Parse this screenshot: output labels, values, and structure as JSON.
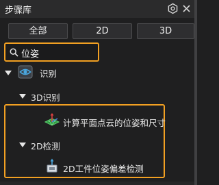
{
  "panel": {
    "title": "步骤库"
  },
  "filters": [
    {
      "label": "全部"
    },
    {
      "label": "2D"
    },
    {
      "label": "3D"
    }
  ],
  "search": {
    "value": "位姿"
  },
  "tree": {
    "root": {
      "label": "识别",
      "icon": "eye-icon"
    },
    "groups": [
      {
        "label": "3D识别",
        "step": {
          "label": "计算平面点云的位姿和尺寸",
          "icon": "plane-cloud-icon"
        }
      },
      {
        "label": "2D检测",
        "step": {
          "label": "2D工件位姿偏差检测",
          "icon": "pose-deviation-icon"
        }
      }
    ]
  },
  "colors": {
    "highlight": "#f2a022",
    "eye_icon": "#4aa8e0",
    "background": "#1f1f20"
  }
}
